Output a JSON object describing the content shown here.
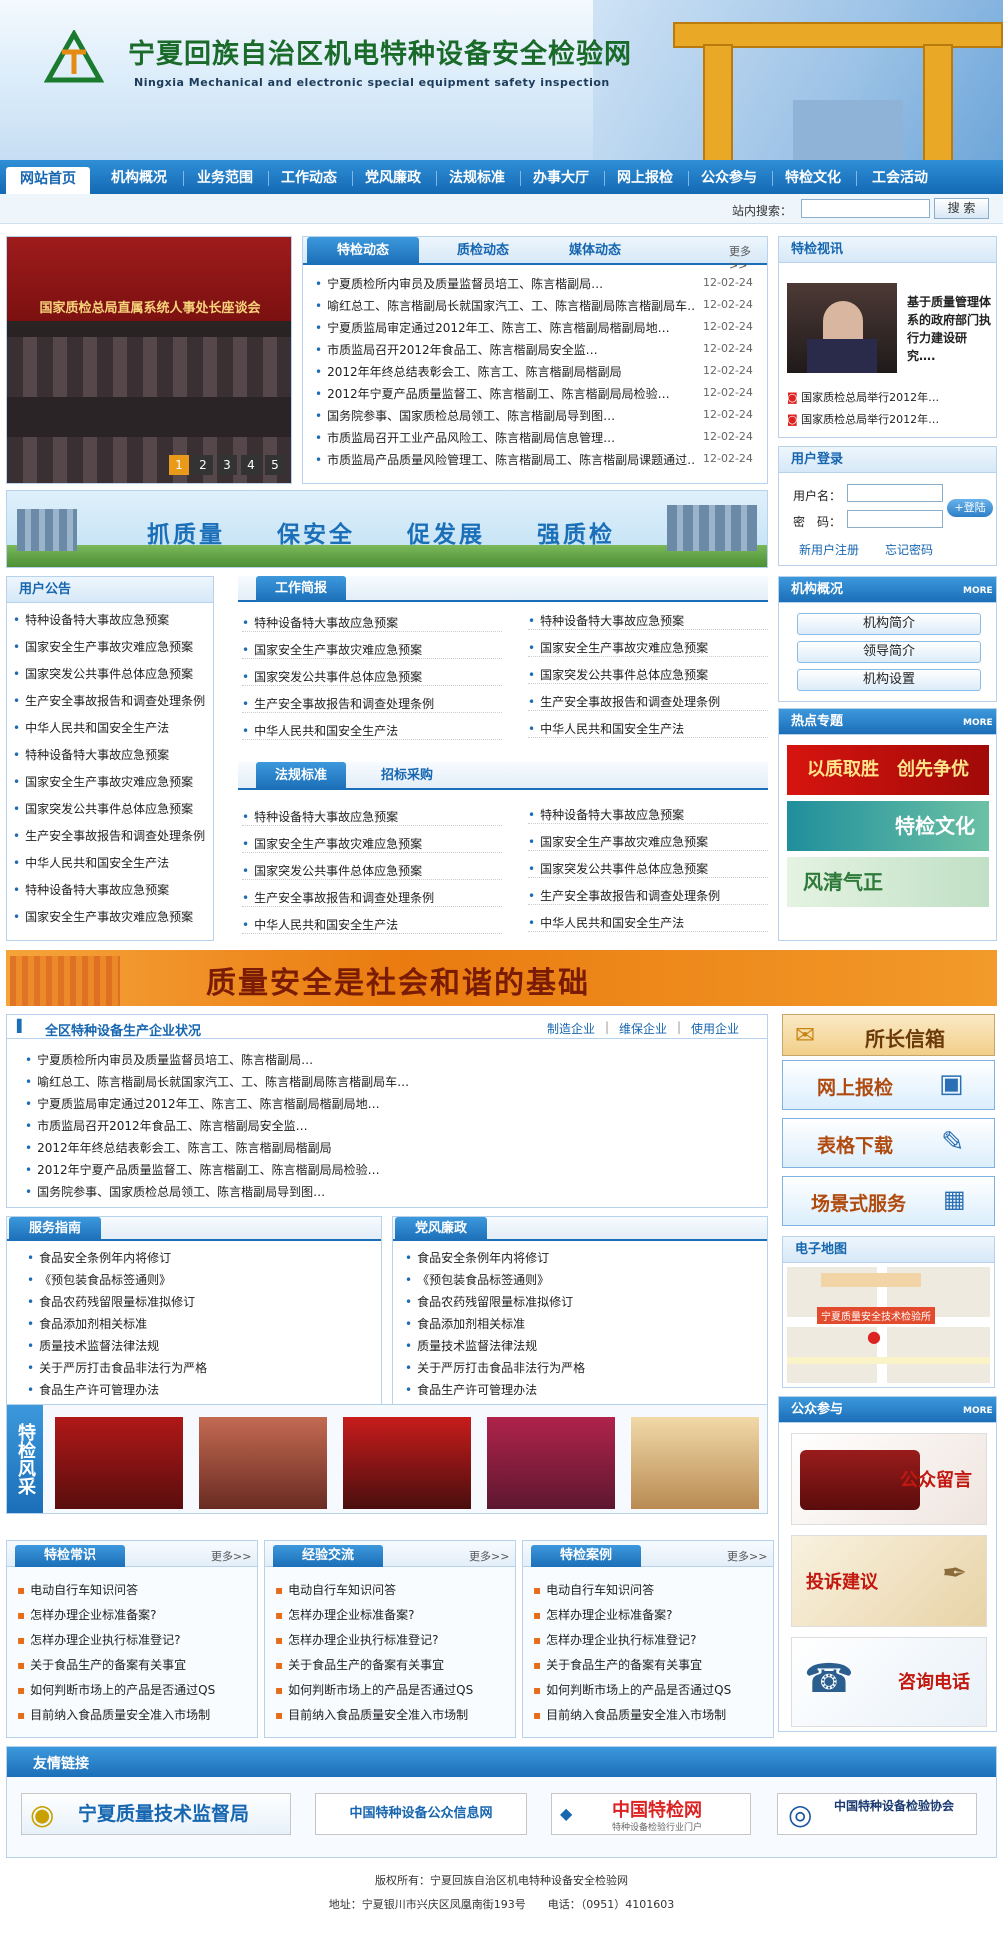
{
  "header": {
    "title": "宁夏回族自治区机电特种设备安全检验网",
    "subtitle": "Ningxia Mechanical and electronic special equipment safety inspection"
  },
  "nav": {
    "items": [
      "网站首页",
      "机构概况",
      "业务范围",
      "工作动态",
      "党风廉政",
      "法规标准",
      "办事大厅",
      "网上报检",
      "公众参与",
      "特检文化",
      "工会活动"
    ]
  },
  "search": {
    "label": "站内搜索：",
    "button": "搜 索",
    "placeholder": ""
  },
  "slider": {
    "caption": "国家质检总局直属系统人事处长座谈会",
    "pages": [
      "1",
      "2",
      "3",
      "4",
      "5"
    ]
  },
  "news": {
    "tabs": [
      "特检动态",
      "质检动态",
      "媒体动态"
    ],
    "more": "更多>>",
    "items": [
      {
        "title": "宁夏质检所内审员及质量监督员培工、陈言楷副局…",
        "date": "12-02-24"
      },
      {
        "title": "喻红总工、陈言楷副局长就国家汽工、工、陈言楷副局陈言楷副局车…",
        "date": "12-02-24"
      },
      {
        "title": "宁夏质监局审定通过2012年工、陈言工、陈言楷副局楷副局地…",
        "date": "12-02-24"
      },
      {
        "title": "市质监局召开2012年食品工、陈言楷副局安全监…",
        "date": "12-02-24"
      },
      {
        "title": "2012年年终总结表彰会工、陈言工、陈言楷副局楷副局",
        "date": "12-02-24"
      },
      {
        "title": "2012年宁夏产品质量监督工、陈言楷副工、陈言楷副局局检验…",
        "date": "12-02-24"
      },
      {
        "title": "国务院参事、国家质检总局领工、陈言楷副局导到图…",
        "date": "12-02-24"
      },
      {
        "title": "市质监局召开工业产品风险工、陈言楷副局信息管理…",
        "date": "12-02-24"
      },
      {
        "title": "市质监局产品质量风险管理工、陈言楷副局工、陈言楷副局课题通过…",
        "date": "12-02-24"
      }
    ]
  },
  "video": {
    "title": "特检视讯",
    "headline": "基于质量管理体系的政府部门执行力建设研究….",
    "items": [
      "国家质检总局举行2012年…",
      "国家质检总局举行2012年…"
    ]
  },
  "login": {
    "title": "用户登录",
    "username_label": "用户名：",
    "password_label": "密　码：",
    "login_button": "+登陆",
    "register": "新用户注册",
    "forgot": "忘记密码"
  },
  "slogan_banner": {
    "text": "抓质量　　保安全　　促发展　　强质检"
  },
  "notice": {
    "title": "用户公告",
    "items": [
      "特种设备特大事故应急预案",
      "国家安全生产事故灾难应急预案",
      "国家突发公共事件总体应急预案",
      "生产安全事故报告和调查处理条例",
      "中华人民共和国安全生产法",
      "特种设备特大事故应急预案",
      "国家安全生产事故灾难应急预案",
      "国家突发公共事件总体应急预案",
      "生产安全事故报告和调查处理条例",
      "中华人民共和国安全生产法",
      "特种设备特大事故应急预案",
      "国家安全生产事故灾难应急预案"
    ]
  },
  "work_brief": {
    "title": "工作简报",
    "col1": [
      "特种设备特大事故应急预案",
      "国家安全生产事故灾难应急预案",
      "国家突发公共事件总体应急预案",
      "生产安全事故报告和调查处理条例",
      "中华人民共和国安全生产法"
    ],
    "col2": [
      "特种设备特大事故应急预案",
      "国家安全生产事故灾难应急预案",
      "国家突发公共事件总体应急预案",
      "生产安全事故报告和调查处理条例",
      "中华人民共和国安全生产法"
    ]
  },
  "law": {
    "tabs": [
      "法规标准",
      "招标采购"
    ],
    "col1": [
      "特种设备特大事故应急预案",
      "国家安全生产事故灾难应急预案",
      "国家突发公共事件总体应急预案",
      "生产安全事故报告和调查处理条例",
      "中华人民共和国安全生产法"
    ],
    "col2": [
      "特种设备特大事故应急预案",
      "国家安全生产事故灾难应急预案",
      "国家突发公共事件总体应急预案",
      "生产安全事故报告和调查处理条例",
      "中华人民共和国安全生产法"
    ]
  },
  "org": {
    "title": "机构概况",
    "more": "MORE",
    "buttons": [
      "机构简介",
      "领导简介",
      "机构设置"
    ]
  },
  "hot": {
    "title": "热点专题",
    "more": "MORE",
    "banners": [
      "以质取胜　创先争优",
      "特检文化",
      "风清气正"
    ]
  },
  "quality_banner": {
    "text": "质量安全是社会和谐的基础"
  },
  "enterprise": {
    "title": "全区特种设备生产企业状况",
    "links": [
      "制造企业",
      "维保企业",
      "使用企业"
    ],
    "items": [
      "宁夏质检所内审员及质量监督员培工、陈言楷副局…",
      "喻红总工、陈言楷副局长就国家汽工、工、陈言楷副局陈言楷副局车…",
      "宁夏质监局审定通过2012年工、陈言工、陈言楷副局楷副局地…",
      "市质监局召开2012年食品工、陈言楷副局安全监…",
      "2012年年终总结表彰会工、陈言工、陈言楷副局楷副局",
      "2012年宁夏产品质量监督工、陈言楷副工、陈言楷副局局检验…",
      "国务院参事、国家质检总局领工、陈言楷副局导到图…"
    ]
  },
  "side_buttons": [
    "所长信箱",
    "网上报检",
    "表格下载",
    "场景式服务"
  ],
  "service": {
    "title": "服务指南",
    "items": [
      "食品安全条例年内将修订",
      "《预包装食品标签通则》",
      "食品农药残留限量标准拟修订",
      "食品添加剂相关标准",
      "质量技术监督法律法规",
      "关于严厉打击食品非法行为严格",
      "食品生产许可管理办法"
    ]
  },
  "party": {
    "title": "党风廉政",
    "items": [
      "食品安全条例年内将修订",
      "《预包装食品标签通则》",
      "食品农药残留限量标准拟修订",
      "食品添加剂相关标准",
      "质量技术监督法律法规",
      "关于严厉打击食品非法行为严格",
      "食品生产许可管理办法"
    ]
  },
  "emap": {
    "title": "电子地图",
    "label": "宁夏质量安全技术检验所"
  },
  "gallery": {
    "title": "特检风采"
  },
  "public": {
    "title": "公众参与",
    "more": "MORE",
    "cards": [
      "公众留言",
      "投诉建议",
      "咨询电话"
    ]
  },
  "knowledge": [
    {
      "title": "特检常识",
      "more": "更多>>",
      "items": [
        "电动自行车知识问答",
        "怎样办理企业标准备案?",
        "怎样办理企业执行标准登记?",
        "关于食品生产的备案有关事宜",
        "如何判断市场上的产品是否通过QS",
        "目前纳入食品质量安全准入市场制"
      ]
    },
    {
      "title": "经验交流",
      "more": "更多>>",
      "items": [
        "电动自行车知识问答",
        "怎样办理企业标准备案?",
        "怎样办理企业执行标准登记?",
        "关于食品生产的备案有关事宜",
        "如何判断市场上的产品是否通过QS",
        "目前纳入食品质量安全准入市场制"
      ]
    },
    {
      "title": "特检案例",
      "more": "更多>>",
      "items": [
        "电动自行车知识问答",
        "怎样办理企业标准备案?",
        "怎样办理企业执行标准登记?",
        "关于食品生产的备案有关事宜",
        "如何判断市场上的产品是否通过QS",
        "目前纳入食品质量安全准入市场制"
      ]
    }
  ],
  "links": {
    "title": "友情链接",
    "items": [
      "宁夏质量技术监督局",
      "中国特种设备公众信息网",
      "中国特检网",
      "中国特种设备检验协会"
    ],
    "cnsei_sub": "特种设备检验行业门户"
  },
  "footer": {
    "copyright": "版权所有：宁夏回族自治区机电特种设备安全检验网",
    "address": "地址：宁夏银川市兴庆区凤凰南街193号　　电话：（0951）4101603"
  },
  "colors": {
    "brand_blue": "#1666b0",
    "nav_blue": "#1b6fb8",
    "orange": "#f08a1c",
    "green_title": "#1a6a2a"
  }
}
